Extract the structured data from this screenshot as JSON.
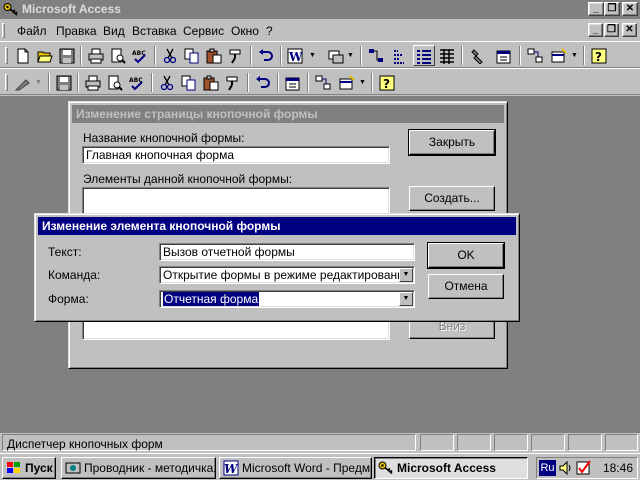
{
  "window": {
    "title": "Microsoft Access"
  },
  "menu": {
    "items": [
      {
        "label": "Файл"
      },
      {
        "label": "Правка"
      },
      {
        "label": "Вид"
      },
      {
        "label": "Вставка"
      },
      {
        "label": "Сервис"
      },
      {
        "label": "Окно"
      },
      {
        "label": "?"
      }
    ]
  },
  "toolbar1": {
    "icons": [
      "toolbar-view-icon",
      "new-icon",
      "open-icon",
      "save-icon",
      "print-icon",
      "print-preview-icon",
      "spelling-icon",
      "cut-icon",
      "copy-icon",
      "paste-icon",
      "format-painter-icon",
      "undo-icon",
      "office-links-icon",
      "analyze-icon",
      "relationships-icon",
      "code-icon",
      "properties-icon",
      "build-icon",
      "database-window-icon",
      "new-object-icon",
      "help-icon"
    ]
  },
  "toolbar2": {
    "icons": [
      "design-view-icon",
      "save-icon",
      "print-icon",
      "print-preview-icon",
      "spelling-icon",
      "cut-icon",
      "copy-icon",
      "paste-icon",
      "format-painter-icon",
      "undo-icon",
      "properties-icon",
      "database-window-icon",
      "new-object-icon",
      "help-icon"
    ]
  },
  "switchboard_page_dialog": {
    "title": "Изменение страницы кнопочной формы",
    "name_label": "Название кнопочной формы:",
    "name_value": "Главная кнопочная форма",
    "items_label": "Элементы данной кнопочной формы:",
    "close_button": "Закрыть",
    "new_button": "Создать...",
    "down_button": "Вниз"
  },
  "edit_item_dialog": {
    "title": "Изменение элемента кнопочной формы",
    "text_label": "Текст:",
    "text_value": "Вызов отчетной формы",
    "command_label": "Команда:",
    "command_value": "Открытие формы в режиме редактирования",
    "form_label": "Форма:",
    "form_value": "Отчетная форма",
    "ok_button": "OK",
    "cancel_button": "Отмена"
  },
  "status": {
    "text": "Диспетчер кнопочных форм"
  },
  "taskbar": {
    "start": "Пуск",
    "tasks": [
      {
        "label": "Проводник - методичка..."
      },
      {
        "label": "Microsoft Word - Предм..."
      },
      {
        "label": "Microsoft Access"
      }
    ],
    "lang": "Ru",
    "time": "18:46"
  }
}
